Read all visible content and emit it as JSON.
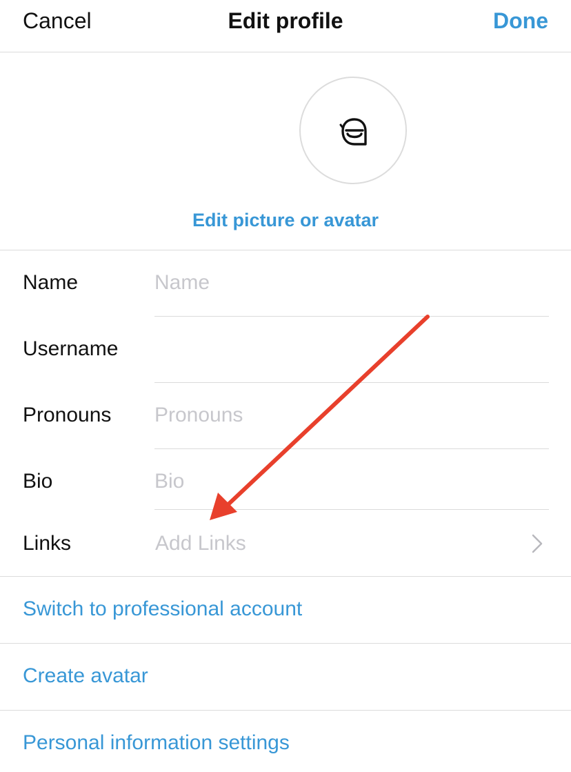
{
  "header": {
    "cancel_label": "Cancel",
    "title": "Edit profile",
    "done_label": "Done"
  },
  "avatar": {
    "icon": "avatar-face-icon",
    "edit_label": "Edit picture or avatar"
  },
  "fields": {
    "name": {
      "label": "Name",
      "value": "",
      "placeholder": "Name"
    },
    "username": {
      "label": "Username",
      "value": "",
      "placeholder": ""
    },
    "pronouns": {
      "label": "Pronouns",
      "value": "",
      "placeholder": "Pronouns"
    },
    "bio": {
      "label": "Bio",
      "value": "",
      "placeholder": "Bio"
    },
    "links": {
      "label": "Links",
      "value": "Add Links",
      "icon": "chevron-right-icon"
    }
  },
  "actions": {
    "switch_professional": "Switch to professional account",
    "create_avatar": "Create avatar",
    "personal_info": "Personal information settings"
  },
  "colors": {
    "accent": "#3897d6",
    "text": "#111111",
    "placeholder": "#c7c7cc",
    "divider": "#dbdbdb",
    "annotation_arrow": "#e8402c"
  }
}
